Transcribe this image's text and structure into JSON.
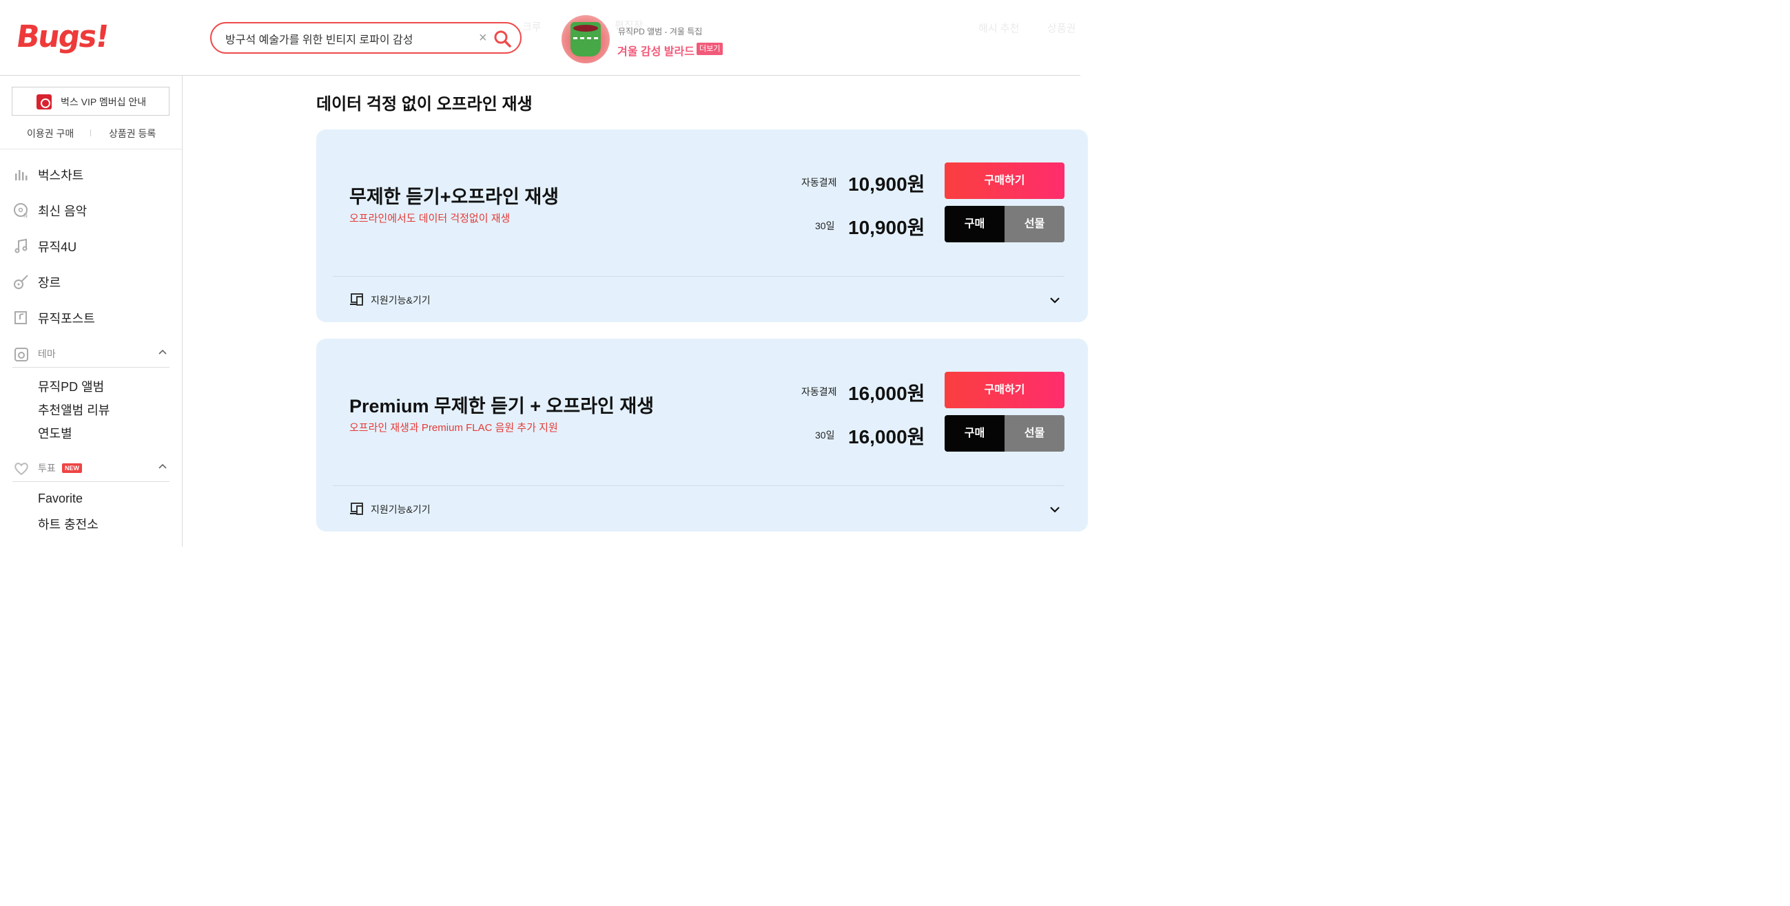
{
  "header": {
    "logo": "Bugs!",
    "search": {
      "value": "방구석 예술가를 위한 빈티지 로파이 감성",
      "placeholder": ""
    },
    "faint_nav": [
      "크루",
      "편집장",
      "해시 추천",
      "상품권"
    ],
    "promo": {
      "subtitle": "뮤직PD 앨범 - 겨울 특집",
      "title": "겨울 감성 발라드",
      "more": "더보기"
    }
  },
  "sidebar": {
    "vip_label": "벅스 VIP 멤버십 안내",
    "links": [
      "이용권 구매",
      "상품권 등록"
    ],
    "nav": [
      {
        "label": "벅스차트",
        "icon": "chart-bars-icon"
      },
      {
        "label": "최신 음악",
        "icon": "new-disc-icon"
      },
      {
        "label": "뮤직4U",
        "icon": "music-note-icon"
      },
      {
        "label": "장르",
        "icon": "guitar-icon"
      },
      {
        "label": "뮤직포스트",
        "icon": "post-icon"
      }
    ],
    "theme": {
      "label": "테마",
      "items": [
        "뮤직PD 앨범",
        "추천앨범 리뷰",
        "연도별"
      ]
    },
    "vote": {
      "label": "투표",
      "badge": "NEW",
      "items": [
        "Favorite",
        "하트 충전소"
      ]
    }
  },
  "main": {
    "title": "데이터 걱정 없이 오프라인 재생",
    "plans": [
      {
        "name": "무제한 듣기+오프라인 재생",
        "desc": "오프라인에서도 데이터 걱정없이 재생",
        "auto_label": "자동결제",
        "auto_price": "10,900원",
        "period_label": "30일",
        "period_price": "10,900원",
        "buy_label": "구매하기",
        "purchase_label": "구매",
        "gift_label": "선물",
        "feature_label": "지원기능&기기"
      },
      {
        "name": "Premium 무제한 듣기 + 오프라인 재생",
        "desc": "오프라인 재생과 Premium FLAC 음원 추가 지원",
        "auto_label": "자동결제",
        "auto_price": "16,000원",
        "period_label": "30일",
        "period_price": "16,000원",
        "buy_label": "구매하기",
        "purchase_label": "구매",
        "gift_label": "선물",
        "feature_label": "지원기능&기기"
      }
    ]
  },
  "colors": {
    "brand": "#ee3a3a",
    "card_bg": "#e4f1fc",
    "buy_gradient_start": "#fa3f3f",
    "buy_gradient_end": "#ff2d6d",
    "desc_red": "#e53935"
  }
}
